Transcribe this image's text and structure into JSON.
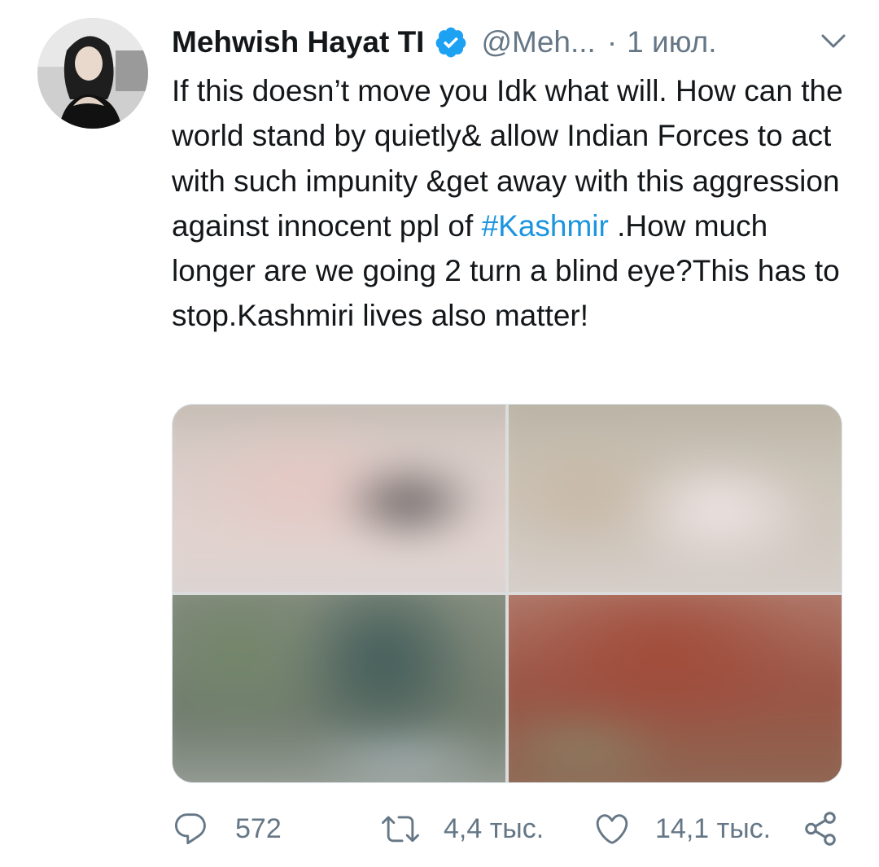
{
  "tweet": {
    "author_name": "Mehwish Hayat TI",
    "handle": "@Meh...",
    "separator": "·",
    "date": "1 июл.",
    "text_before_hashtag": "If this doesn’t move you Idk what will.  How can the world stand by quietly& allow Indian Forces to act with such impunity &get away with this aggression against innocent ppl of ",
    "hashtag": "#Kashmir",
    "text_after_hashtag": " .How much longer are we going 2 turn a blind eye?This has to stop.Kashmiri lives also matter!"
  },
  "actions": {
    "replies": "572",
    "retweets": "4,4 тыс.",
    "likes": "14,1 тыс."
  },
  "icons": {
    "verified": "verified-badge-icon",
    "more": "chevron-down-icon",
    "reply": "reply-icon",
    "retweet": "retweet-icon",
    "like": "heart-icon",
    "share": "share-icon"
  },
  "colors": {
    "text": "#14171a",
    "secondary": "#657786",
    "link": "#1b95e0",
    "verified": "#1da1f2"
  }
}
